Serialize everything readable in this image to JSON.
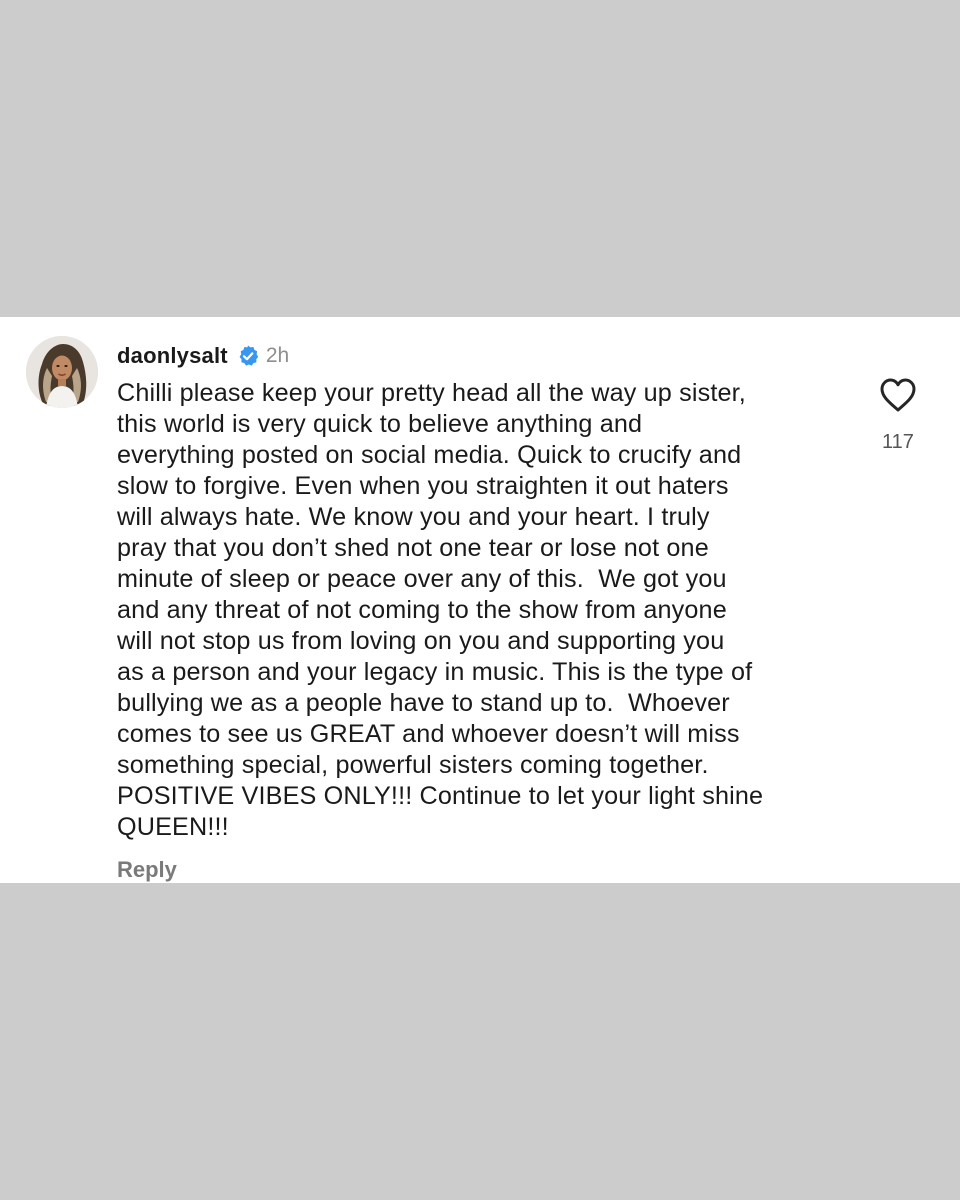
{
  "comment": {
    "username": "daonlysalt",
    "verified_icon": "verified-badge-icon",
    "time": "2h",
    "text_lines": [
      "Chilli please keep your pretty head all the way up sister,",
      "this world is very quick to believe anything and",
      "everything posted on social media. Quick to crucify and",
      "slow to forgive. Even when you straighten it out haters",
      "will always hate. We know you and your heart. I truly",
      "pray that you don’t shed not one tear or lose not one",
      "minute of sleep or peace over any of this.  We got you",
      "and any threat of not coming to the show from anyone",
      "will not stop us from loving on you and supporting you",
      "as a person and your legacy in music. This is the type of",
      "bullying we as a people have to stand up to.  Whoever",
      "comes to see us GREAT and whoever doesn’t will miss",
      "something special, powerful sisters coming together.",
      "POSITIVE VIBES ONLY!!! Continue to let your light shine",
      "QUEEN!!!"
    ],
    "reply_label": "Reply",
    "like_icon": "heart-outline-icon",
    "like_count": "117"
  },
  "colors": {
    "background": "#cccccc",
    "card": "#ffffff",
    "verified": "#3797f0",
    "muted_text": "#8e8e8e"
  }
}
